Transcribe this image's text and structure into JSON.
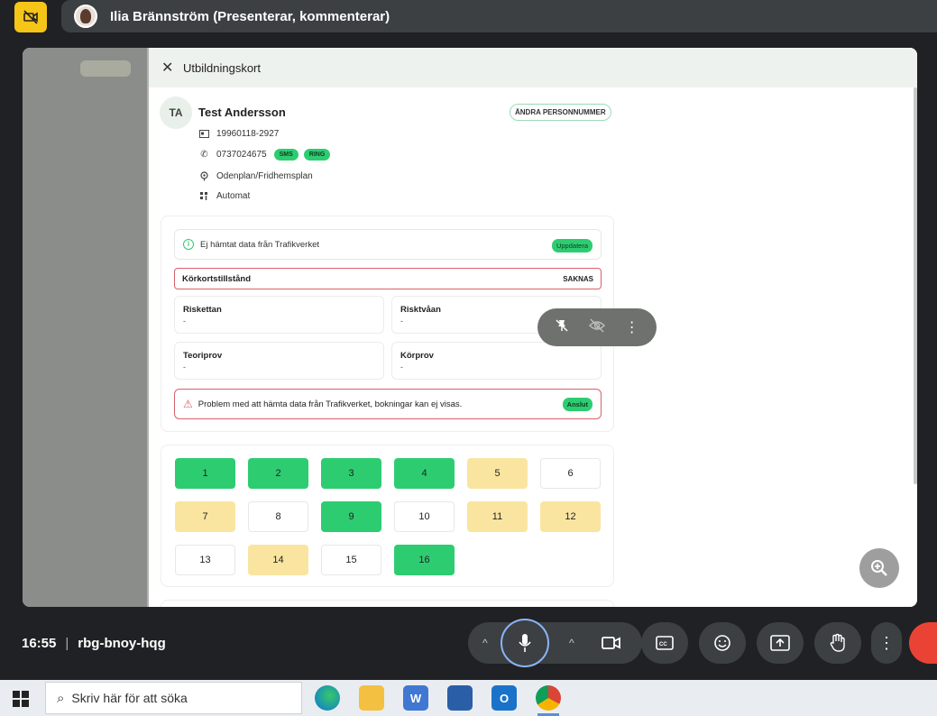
{
  "meet": {
    "presenter": "Ilia Brännström (Presenterar, kommenterar)",
    "time": "16:55",
    "meeting_code": "rbg-bnoy-hqg"
  },
  "panel": {
    "title": "Utbildningskort",
    "avatar_initials": "TA",
    "name": "Test Andersson",
    "change_pn_label": "ÄNDRA PERSONNUMMER",
    "personnummer": "19960118-2927",
    "phone": "0737024675",
    "sms_label": "SMS",
    "call_label": "RING",
    "location": "Odenplan/Fridhemsplan",
    "gearbox": "Automat"
  },
  "trafikverket": {
    "status_text": "Ej hämtat data från Trafikverket",
    "update_label": "Uppdatera",
    "permit_label": "Körkortstillstånd",
    "permit_value": "SAKNAS",
    "riskettan_label": "Riskettan",
    "riskettan_value": "-",
    "risktvaan_label": "Risktvåan",
    "risktvaan_value": "-",
    "teoriprov_label": "Teoriprov",
    "teoriprov_value": "-",
    "korprov_label": "Körprov",
    "korprov_value": "-",
    "problem_text": "Problem med att hämta data från Trafikverket, bokningar kan ej visas.",
    "connect_label": "Anslut"
  },
  "lessons": [
    {
      "n": "1",
      "status": "done"
    },
    {
      "n": "2",
      "status": "done"
    },
    {
      "n": "3",
      "status": "done"
    },
    {
      "n": "4",
      "status": "done"
    },
    {
      "n": "5",
      "status": "partial"
    },
    {
      "n": "6",
      "status": "none"
    },
    {
      "n": "7",
      "status": "partial"
    },
    {
      "n": "8",
      "status": "none"
    },
    {
      "n": "9",
      "status": "done"
    },
    {
      "n": "10",
      "status": "none"
    },
    {
      "n": "11",
      "status": "partial"
    },
    {
      "n": "12",
      "status": "partial"
    },
    {
      "n": "13",
      "status": "none"
    },
    {
      "n": "14",
      "status": "partial"
    },
    {
      "n": "15",
      "status": "none"
    },
    {
      "n": "16",
      "status": "done"
    }
  ],
  "taskbar": {
    "search_placeholder": "Skriv här för att söka"
  },
  "colors": {
    "accent_green": "#2ecc71",
    "partial_yellow": "#fae5a0",
    "error_red": "#d8616a",
    "cam_off_yellow": "#f5c518",
    "leave_red": "#ea4335"
  },
  "icons": [
    "camera-off-icon",
    "close-icon",
    "id-card-icon",
    "phone-icon",
    "location-pin-icon",
    "gearbox-icon",
    "info-icon",
    "warning-icon",
    "pin-off-icon",
    "eye-off-icon",
    "more-vertical-icon",
    "zoom-in-icon",
    "microphone-icon",
    "camera-icon",
    "captions-icon",
    "emoji-icon",
    "present-icon",
    "raise-hand-icon",
    "windows-logo-icon",
    "search-icon"
  ]
}
